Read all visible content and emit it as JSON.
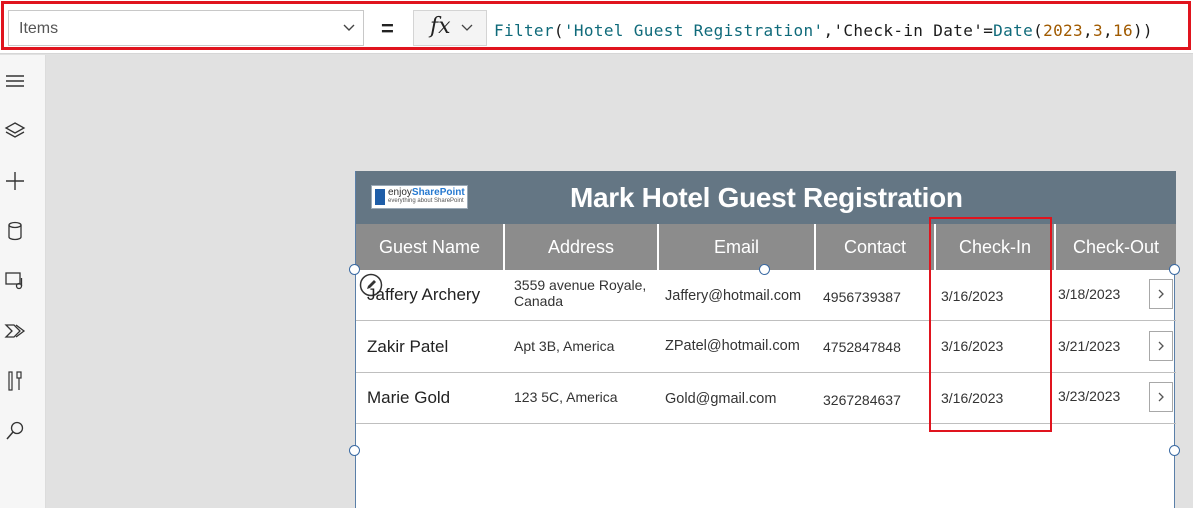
{
  "formula_bar": {
    "property": "Items",
    "equals": "=",
    "fx": "fx",
    "formula_parts": [
      {
        "t": "Filter",
        "k": "fn"
      },
      {
        "t": "(",
        "k": "punc"
      },
      {
        "t": "'Hotel Guest Registration'",
        "k": "str"
      },
      {
        "t": ",",
        "k": "punc"
      },
      {
        "t": "'Check-in Date'",
        "k": "punc"
      },
      {
        "t": "=",
        "k": "punc"
      },
      {
        "t": "Date",
        "k": "fn"
      },
      {
        "t": "(",
        "k": "punc"
      },
      {
        "t": "2023",
        "k": "num"
      },
      {
        "t": ",",
        "k": "punc"
      },
      {
        "t": "3",
        "k": "num"
      },
      {
        "t": ",",
        "k": "punc"
      },
      {
        "t": "16",
        "k": "num"
      },
      {
        "t": "))",
        "k": "punc"
      }
    ]
  },
  "left_rail": {
    "icons": [
      "hamburger-icon",
      "layers-icon",
      "plus-icon",
      "data-icon",
      "media-icon",
      "power-automate-icon",
      "tools-icon",
      "search-icon"
    ]
  },
  "app": {
    "logo": {
      "enjoy": "enjoy",
      "brand": "SharePoint",
      "tagline": "everything about SharePoint"
    },
    "title": "Mark Hotel Guest Registration",
    "columns": [
      "Guest Name",
      "Address",
      "Email",
      "Contact",
      "Check-In",
      "Check-Out"
    ],
    "rows": [
      {
        "name": "Jaffery Archery",
        "address_line1": "3559 avenue Royale,",
        "address_line2": "Canada",
        "email": "Jaffery@hotmail.com",
        "contact": "4956739387",
        "check_in": "3/16/2023",
        "check_out": "3/18/2023"
      },
      {
        "name": "Zakir Patel",
        "address_line1": "Apt 3B, America",
        "address_line2": "",
        "email": "ZPatel@hotmail.com",
        "contact": "4752847848",
        "check_in": "3/16/2023",
        "check_out": "3/21/2023"
      },
      {
        "name": "Marie Gold",
        "address_line1": "123 5C, America",
        "address_line2": "",
        "email": "Gold@gmail.com",
        "contact": "3267284637",
        "check_in": "3/16/2023",
        "check_out": "3/23/2023"
      }
    ]
  },
  "colors": {
    "highlight": "#e0141e",
    "header_bg": "#647684",
    "column_header_bg": "#8c8c8c",
    "selection": "#3a6aa3"
  }
}
